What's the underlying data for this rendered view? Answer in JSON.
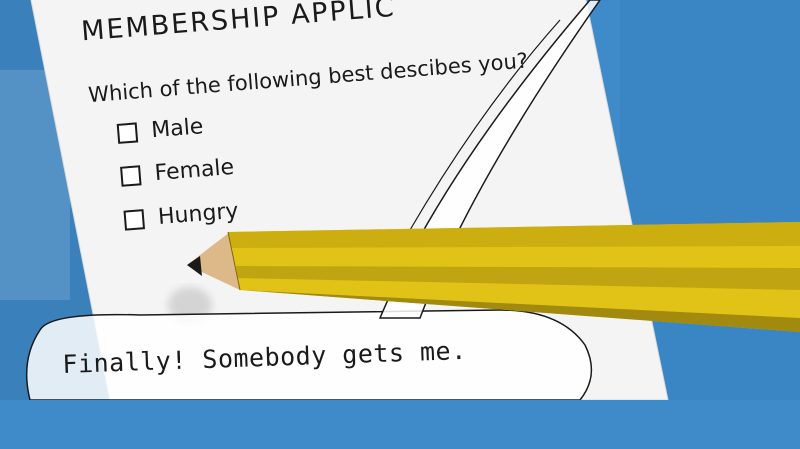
{
  "form": {
    "title": "MEMBERSHIP APPLIC",
    "question": "Which of the following best descibes you?",
    "options": [
      "Male",
      "Female",
      "Hungry"
    ]
  },
  "speech_bubble": {
    "text": "Finally! Somebody gets me."
  },
  "colors": {
    "background": "#3f8ac8",
    "paper": "#f4f4f4",
    "pencil_body": "#e0c316",
    "pencil_shadow": "#b89c10",
    "pencil_wood": "#ddb888",
    "ink": "#1a1a1a"
  }
}
